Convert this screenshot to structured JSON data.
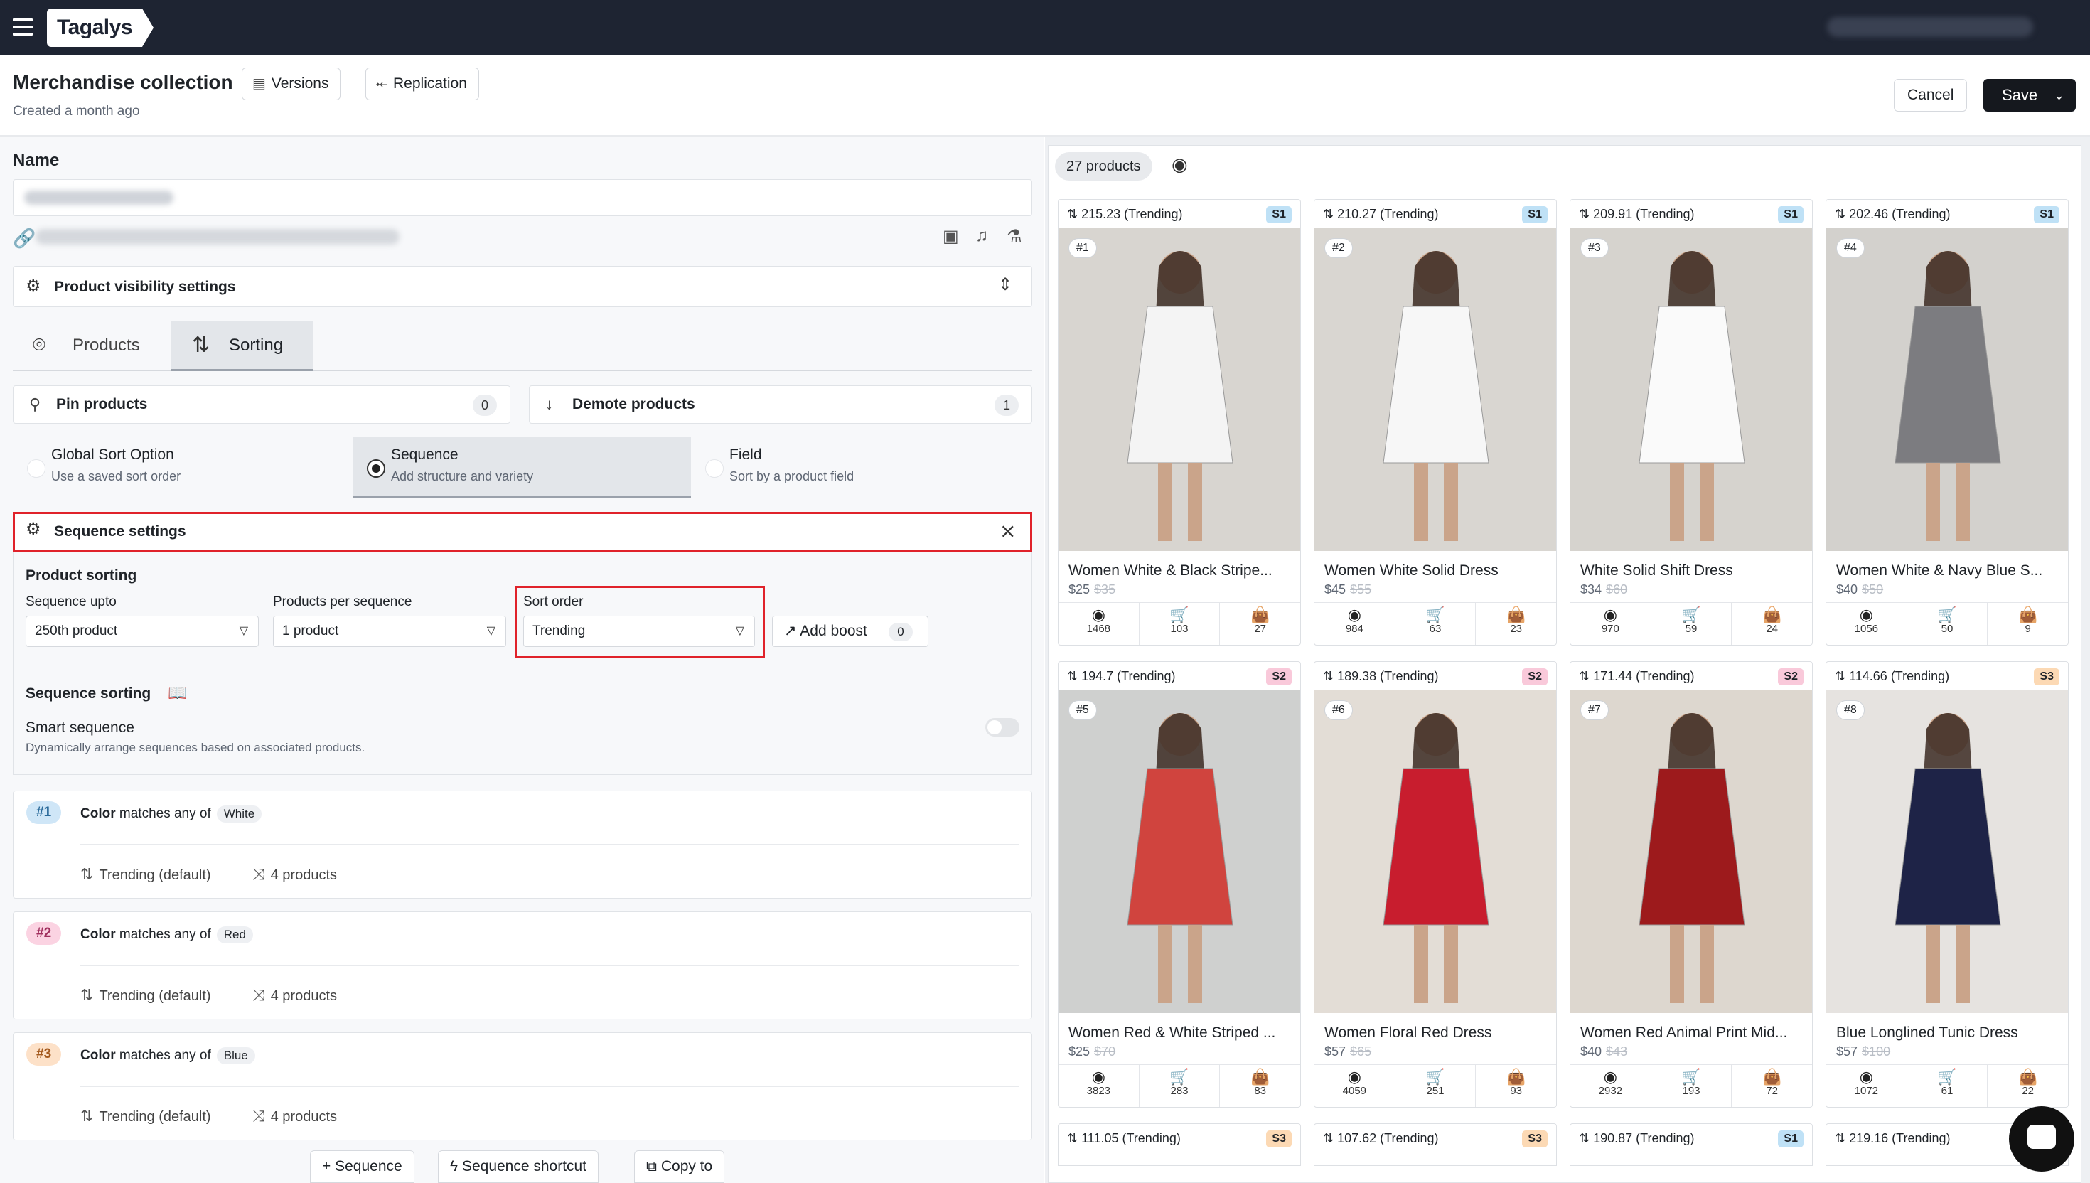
{
  "app": {
    "logo": "Tagalys"
  },
  "header": {
    "title": "Merchandise collection",
    "created": "Created a month ago",
    "versions_label": "Versions",
    "replication_label": "Replication",
    "cancel_label": "Cancel",
    "save_label": "Save"
  },
  "left": {
    "name_label": "Name",
    "visibility_label": "Product visibility settings",
    "tabs": [
      {
        "label": "Products"
      },
      {
        "label": "Sorting"
      }
    ],
    "pin_label": "Pin products",
    "pin_count": "0",
    "demote_label": "Demote products",
    "demote_count": "1",
    "sort_options": [
      {
        "title": "Global Sort Option",
        "sub": "Use a saved sort order"
      },
      {
        "title": "Sequence",
        "sub": "Add structure and variety"
      },
      {
        "title": "Field",
        "sub": "Sort by a product field"
      }
    ],
    "sequence_settings_label": "Sequence settings",
    "product_sorting_label": "Product sorting",
    "sequence_upto_label": "Sequence upto",
    "sequence_upto_value": "250th product",
    "pps_label": "Products per sequence",
    "pps_value": "1 product",
    "sort_order_label": "Sort order",
    "sort_order_value": "Trending",
    "add_boost_label": "Add boost",
    "boost_count": "0",
    "sequence_sorting_label": "Sequence sorting",
    "smart_label": "Smart sequence",
    "smart_desc": "Dynamically arrange sequences based on associated products.",
    "rules": [
      {
        "num": "#1",
        "field": "Color",
        "op": "matches any of",
        "value": "White",
        "sort": "Trending (default)",
        "products": "4 products",
        "bg": "#cfe6f7",
        "fg": "#2a6a9a"
      },
      {
        "num": "#2",
        "field": "Color",
        "op": "matches any of",
        "value": "Red",
        "sort": "Trending (default)",
        "products": "4 products",
        "bg": "#fbd3e2",
        "fg": "#a0305e"
      },
      {
        "num": "#3",
        "field": "Color",
        "op": "matches any of",
        "value": "Blue",
        "sort": "Trending (default)",
        "products": "4 products",
        "bg": "#fde1c8",
        "fg": "#a45a1f"
      }
    ],
    "add_sequence_label": "+ Sequence",
    "shortcut_label": "Sequence shortcut",
    "copy_label": "Copy to"
  },
  "right": {
    "product_count": "27 products",
    "cards": [
      {
        "score": "215.23 (Trending)",
        "badge": "S1",
        "rank": "#1",
        "name": "Women White & Black Stripe...",
        "price": "$25",
        "orig": "$35",
        "views": "1468",
        "carts": "103",
        "buys": "27"
      },
      {
        "score": "210.27 (Trending)",
        "badge": "S1",
        "rank": "#2",
        "name": "Women White Solid Dress",
        "price": "$45",
        "orig": "$55",
        "views": "984",
        "carts": "63",
        "buys": "23"
      },
      {
        "score": "209.91 (Trending)",
        "badge": "S1",
        "rank": "#3",
        "name": "White Solid Shift Dress",
        "price": "$34",
        "orig": "$60",
        "views": "970",
        "carts": "59",
        "buys": "24"
      },
      {
        "score": "202.46 (Trending)",
        "badge": "S1",
        "rank": "#4",
        "name": "Women White & Navy Blue S...",
        "price": "$40",
        "orig": "$50",
        "views": "1056",
        "carts": "50",
        "buys": "9"
      },
      {
        "score": "194.7 (Trending)",
        "badge": "S2",
        "rank": "#5",
        "name": "Women Red & White Striped ...",
        "price": "$25",
        "orig": "$70",
        "views": "3823",
        "carts": "283",
        "buys": "83"
      },
      {
        "score": "189.38 (Trending)",
        "badge": "S2",
        "rank": "#6",
        "name": "Women Floral Red Dress",
        "price": "$57",
        "orig": "$65",
        "views": "4059",
        "carts": "251",
        "buys": "93"
      },
      {
        "score": "171.44 (Trending)",
        "badge": "S2",
        "rank": "#7",
        "name": "Women Red Animal Print Mid...",
        "price": "$40",
        "orig": "$43",
        "views": "2932",
        "carts": "193",
        "buys": "72"
      },
      {
        "score": "114.66 (Trending)",
        "badge": "S3",
        "rank": "#8",
        "name": "Blue Longlined Tunic Dress",
        "price": "$57",
        "orig": "$100",
        "views": "1072",
        "carts": "61",
        "buys": "22"
      }
    ],
    "next_row": [
      {
        "score": "111.05 (Trending)",
        "badge": "S3"
      },
      {
        "score": "107.62 (Trending)",
        "badge": "S3"
      },
      {
        "score": "190.87 (Trending)",
        "badge": "S1"
      },
      {
        "score": "219.16 (Trending)",
        "badge": ""
      }
    ],
    "badge_colors": {
      "S1": "#bfe1f6",
      "S2": "#f9c9da",
      "S3": "#fcd9b4"
    }
  }
}
